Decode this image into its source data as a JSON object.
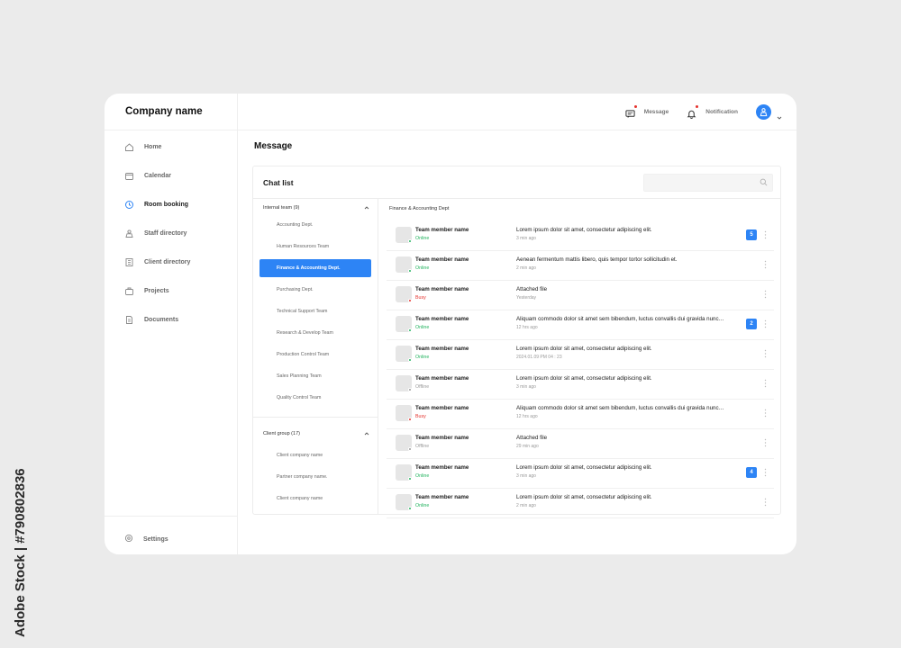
{
  "watermark": {
    "text": "Adobe Stock | #790802836"
  },
  "app": {
    "company_name": "Company name"
  },
  "sidebar": {
    "items": [
      {
        "label": "Home",
        "icon": "home-icon"
      },
      {
        "label": "Calendar",
        "icon": "calendar-icon"
      },
      {
        "label": "Room booking",
        "icon": "clock-icon",
        "active": true
      },
      {
        "label": "Staff directory",
        "icon": "staff-icon"
      },
      {
        "label": "Client directory",
        "icon": "building-icon"
      },
      {
        "label": "Projects",
        "icon": "briefcase-icon"
      },
      {
        "label": "Documents",
        "icon": "document-icon"
      }
    ],
    "settings_label": "Settings"
  },
  "topbar": {
    "message_label": "Message",
    "notification_label": "Notification"
  },
  "main": {
    "title": "Message",
    "chat_list_title": "Chat list",
    "search_placeholder": "",
    "internal_group": {
      "label": "Internal team (9)",
      "teams": [
        "Accounting Dept.",
        "Human Resources Team",
        "Finance & Accounting Dept.",
        "Purchasing Dept.",
        "Technical Support Team",
        "Research & Develop Team",
        "Production Control Team",
        "Sales Planning Team",
        "Quality Control Team"
      ],
      "active_index": 2
    },
    "client_group": {
      "label": "Client group (17)",
      "items": [
        "Client company name",
        "Partner company name.",
        "Client company name"
      ]
    },
    "dept_label": "Finance & Accounting Dept",
    "chats": [
      {
        "name": "Team member name",
        "status": "Online",
        "message": "Lorem ipsum dolor sit amet, consectetur adipiscing elit.",
        "time": "3 min ago",
        "badge": "5"
      },
      {
        "name": "Team member name",
        "status": "Online",
        "message": "Aenean fermentum mattis libero, quis tempor tortor sollicitudin et.",
        "time": "2 min ago",
        "badge": ""
      },
      {
        "name": "Team member name",
        "status": "Busy",
        "message": "Attached file",
        "time": "Yesterday",
        "badge": ""
      },
      {
        "name": "Team member name",
        "status": "Online",
        "message": "Aliquam commodo dolor sit amet sem bibendum, luctus convallis dui gravida nunc…",
        "time": "12 hrs ago",
        "badge": "2"
      },
      {
        "name": "Team member name",
        "status": "Online",
        "message": "Lorem ipsum dolor sit amet, consectetur adipiscing elit.",
        "time": "2024.01.09 PM 04 : 23",
        "badge": ""
      },
      {
        "name": "Team member name",
        "status": "Offline",
        "message": "Lorem ipsum dolor sit amet, consectetur adipiscing elit.",
        "time": "3 min ago",
        "badge": ""
      },
      {
        "name": "Team member name",
        "status": "Busy",
        "message": "Aliquam commodo dolor sit amet sem bibendum, luctus convallis dui gravida nunc…",
        "time": "12 hrs ago",
        "badge": ""
      },
      {
        "name": "Team member name",
        "status": "Offline",
        "message": "Attached file",
        "time": "29 min ago",
        "badge": ""
      },
      {
        "name": "Team member name",
        "status": "Online",
        "message": "Lorem ipsum dolor sit amet, consectetur adipiscing elit.",
        "time": "3 min ago",
        "badge": "4"
      },
      {
        "name": "Team member name",
        "status": "Online",
        "message": "Lorem ipsum dolor sit amet, consectetur adipiscing elit.",
        "time": "2 min ago",
        "badge": ""
      }
    ]
  },
  "colors": {
    "accent": "#2d84f5",
    "online": "#22b35e",
    "busy": "#e5322d",
    "offline": "#9a9a9a",
    "notification_dot": "#e5322d"
  }
}
